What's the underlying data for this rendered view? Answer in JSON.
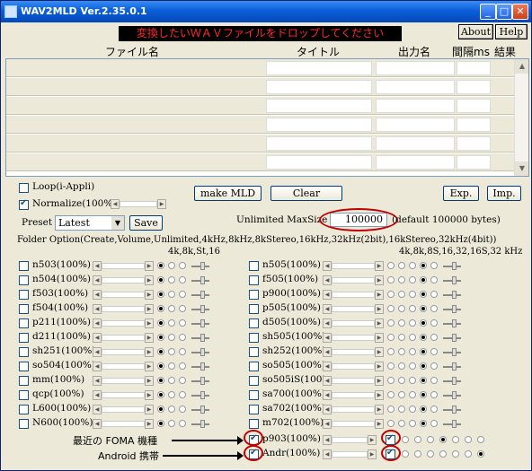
{
  "window": {
    "title": "WAV2MLD Ver.2.35.0.1",
    "drop_banner": "変換したいＷＡＶファイルをドロップしてください"
  },
  "buttons": {
    "about": "About",
    "help": "Help",
    "make": "make MLD",
    "clear": "Clear",
    "exp": "Exp.",
    "imp": "Imp.",
    "save": "Save"
  },
  "columns": {
    "file": "ファイル名",
    "title": "タイトル",
    "out": "出力名",
    "interval": "間隔ms",
    "result": "結果"
  },
  "options": {
    "loop": "Loop(i-Appli)",
    "normalize": "Normalize(100%)",
    "preset_label": "Preset",
    "preset_value": "Latest",
    "maxsize_label": "Unlimited MaxSize",
    "maxsize_value": "100000",
    "maxsize_default": "(default 100000 bytes)",
    "folder_option": "Folder Option(Create,Volume,Unlimited,4kHz,8kHz,8kStereo,16kHz,32kHz(2bit),16kStereo,32kHz(4bit))",
    "left_hdr": "4k,8k,St,16",
    "right_hdr": "4k,8k,8S,16,32,16S,32 kHz"
  },
  "devices_left": [
    "n503(100%)",
    "n504(100%)",
    "f503(100%)",
    "f504(100%)",
    "p211(100%)",
    "d211(100%)",
    "sh251(100%)",
    "so504(100%)",
    "mm(100%)",
    "qcp(100%)",
    "L600(100%)",
    "N600(100%)"
  ],
  "devices_right": [
    "n505(100%)",
    "f505(100%)",
    "p900(100%)",
    "p505(100%)",
    "d505(100%)",
    "sh505(100%)",
    "sh252(100%)",
    "so505(100%)",
    "so505iS(100'",
    "sa700(100%)",
    "sa702(100%)",
    "m702(100%)"
  ],
  "foma": {
    "p903": "p903(100%)",
    "andr": "Andr(100%)"
  },
  "annotations": {
    "foma": "最近の FOMA 機種",
    "android": "Android 携帯"
  },
  "icons": {
    "app": "app-icon",
    "minimize": "minimize-icon",
    "maximize": "maximize-icon",
    "close": "close-icon"
  }
}
